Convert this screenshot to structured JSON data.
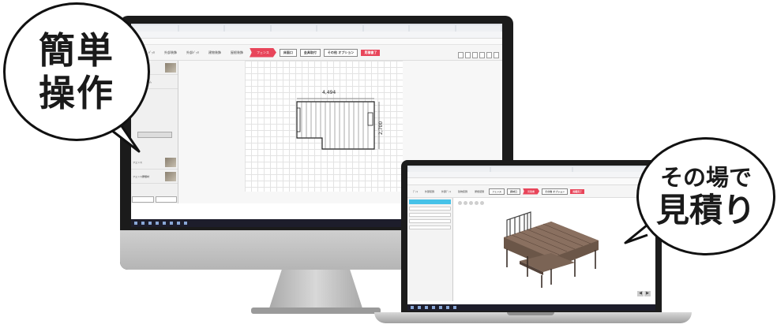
{
  "bubble_left": {
    "line1": "簡単",
    "line2": "操作"
  },
  "bubble_right": {
    "line1": "その場で",
    "line2": "見積り"
  },
  "desktop_app": {
    "nav": [
      "ﾃﾞｯｷ",
      "外部装飾",
      "外部ﾃﾞｯｷ",
      "建物装飾",
      "屋根装飾"
    ],
    "active_step": "フェンス",
    "steps": [
      "床面口",
      "金具取付"
    ],
    "option_label": "その他\nオプション",
    "finish_label": "見積書了",
    "deck_width": "4,494",
    "deck_depth": "2,700",
    "sidebar": [
      "フェンス",
      "プラットフォーム",
      "フェンス",
      "フェンス屋根材"
    ]
  },
  "laptop_app": {
    "nav": [
      "ﾃﾞｯｷ",
      "外部装飾",
      "外部ﾃﾞｯｷ",
      "建物装飾",
      "屋根装飾"
    ],
    "active_step": "見積書",
    "steps": [
      "フェンス",
      "床材口"
    ],
    "option_label": "その他\nオプション",
    "finish_label": "見積完了"
  }
}
